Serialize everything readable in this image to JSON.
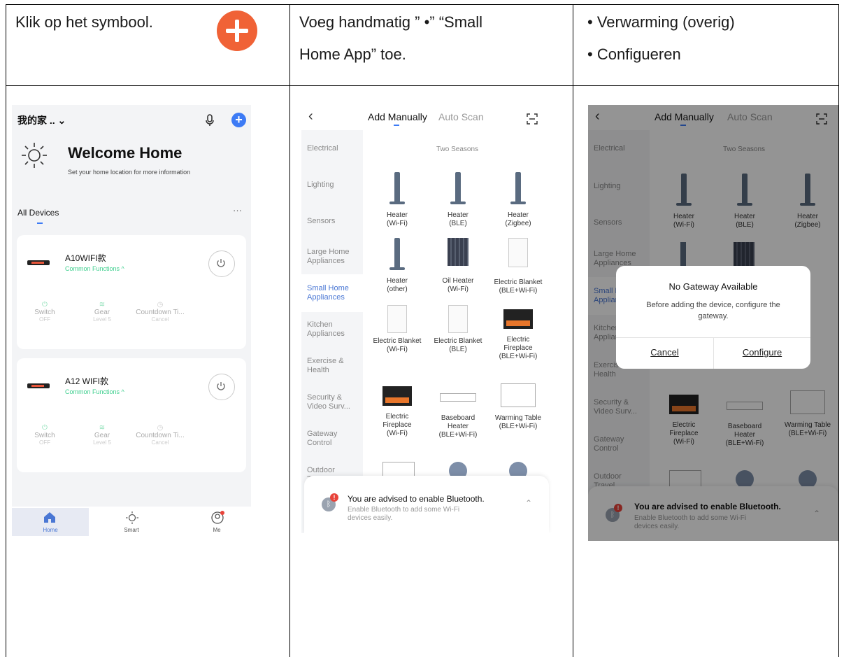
{
  "instructions": {
    "col1": "Klik op het symbool.",
    "col2_line1": "Voeg handmatig ” •” “Small",
    "col2_line2": "Home App” toe.",
    "col3_line1": "• Verwarming (overig)",
    "col3_line2": "• Configueren"
  },
  "home": {
    "home_name": "我的家 ..",
    "welcome": "Welcome Home",
    "welcome_sub": "Set your home location for more information",
    "all_devices": "All Devices",
    "more": "···",
    "devices": [
      {
        "name": "A10WIFI款",
        "common": "Common Functions ^"
      },
      {
        "name": "A12 WIFI款",
        "common": "Common Functions ^"
      }
    ],
    "functions": [
      {
        "name": "Switch",
        "state": "OFF"
      },
      {
        "name": "Gear",
        "state": "Level 5"
      },
      {
        "name": "Countdown Ti...",
        "state": "Cancel"
      }
    ],
    "tabs": [
      "Home",
      "Smart",
      "Me"
    ],
    "accent": "#3d7bf5"
  },
  "add": {
    "tab_manual": "Add Manually",
    "tab_auto": "Auto Scan",
    "categories": [
      "Electrical",
      "Lighting",
      "Sensors",
      "Large Home Appliances",
      "Small Home Appliances",
      "Kitchen Appliances",
      "Exercise & Health",
      "Security & Video Surv...",
      "Gateway Control",
      "Outdoor Travel"
    ],
    "section": "Two Seasons",
    "products": [
      {
        "l1": "Heater",
        "l2": "(Wi-Fi)",
        "l3": ""
      },
      {
        "l1": "Heater",
        "l2": "(BLE)",
        "l3": ""
      },
      {
        "l1": "Heater",
        "l2": "(Zigbee)",
        "l3": ""
      },
      {
        "l1": "Heater",
        "l2": "(other)",
        "l3": ""
      },
      {
        "l1": "Oil Heater",
        "l2": "(Wi-Fi)",
        "l3": ""
      },
      {
        "l1": "Electric Blanket",
        "l2": "(BLE+Wi-Fi)",
        "l3": ""
      },
      {
        "l1": "Electric Blanket",
        "l2": "(Wi-Fi)",
        "l3": ""
      },
      {
        "l1": "Electric Blanket",
        "l2": "(BLE)",
        "l3": ""
      },
      {
        "l1": "Electric",
        "l2": "Fireplace",
        "l3": "(BLE+Wi-Fi)"
      },
      {
        "l1": "Electric",
        "l2": "Fireplace",
        "l3": "(Wi-Fi)"
      },
      {
        "l1": "Baseboard",
        "l2": "Heater",
        "l3": "(BLE+Wi-Fi)"
      },
      {
        "l1": "Warming Table",
        "l2": "(BLE+Wi-Fi)",
        "l3": ""
      }
    ],
    "bt_title": "You are advised to enable Bluetooth.",
    "bt_sub1": "Enable Bluetooth to add some Wi-Fi",
    "bt_sub2": "devices easily."
  },
  "dialog": {
    "title": "No Gateway Available",
    "msg1": "Before adding the device, configure the",
    "msg2": "gateway.",
    "cancel": "Cancel",
    "configure": "Configure"
  }
}
